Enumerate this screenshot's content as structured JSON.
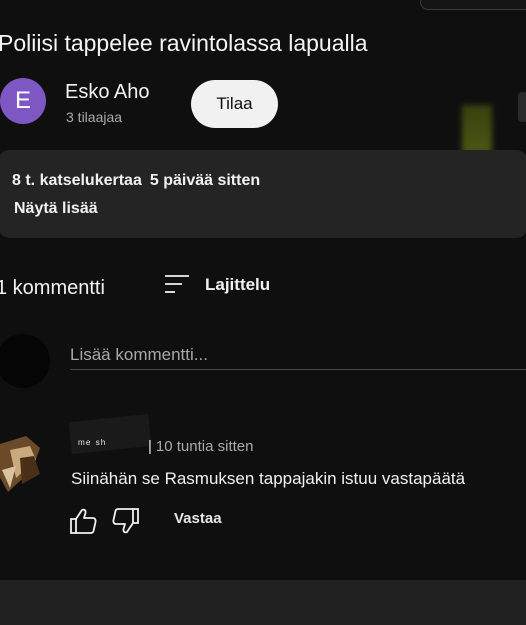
{
  "video": {
    "title": "Poliisi tappelee ravintolassa lapualla"
  },
  "channel": {
    "avatar_letter": "E",
    "avatar_color": "#7e57c2",
    "name": "Esko Aho",
    "subscribers": "3 tilaajaa",
    "subscribe_label": "Tilaa"
  },
  "description": {
    "views": "8 t. katselukertaa",
    "age": "5 päivää sitten",
    "show_more": "Näytä lisää"
  },
  "comments": {
    "count_label": "1 kommentti",
    "sort_label": "Lajittelu",
    "add_placeholder": "Lisää kommentti...",
    "items": [
      {
        "author": "ᵐᵉ ˢʰ",
        "time": "10 tuntia sitten",
        "text": "Siinähän se Rasmuksen tappajakin istuu vastapäätä",
        "reply_label": "Vastaa"
      }
    ]
  },
  "icons": {
    "like": "thumb-up-icon",
    "dislike": "thumb-down-icon",
    "sort": "sort-lines-icon"
  }
}
